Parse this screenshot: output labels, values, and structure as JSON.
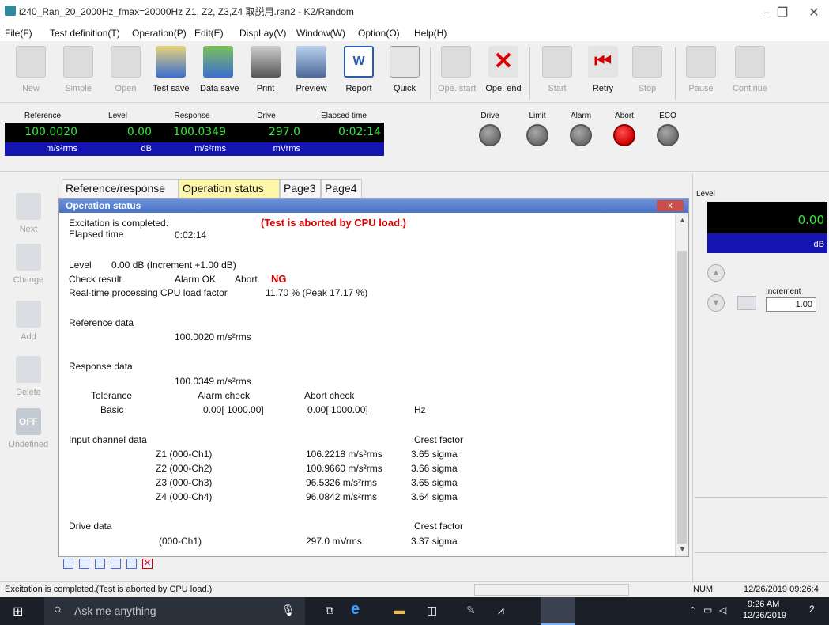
{
  "window": {
    "title": "i240_Ran_20_2000Hz_fmax=20000Hz Z1, Z2, Z3,Z4 取説用.ran2 - K2/Random",
    "minimize": "–",
    "maximize": "❐",
    "close": "✕"
  },
  "menu": [
    "File(F)",
    "Test definition(T)",
    "Operation(P)",
    "Edit(E)",
    "DispLay(V)",
    "Window(W)",
    "Option(O)",
    "Help(H)"
  ],
  "toolbar": {
    "new": "New",
    "simple": "Simple",
    "open": "Open",
    "test_save": "Test save",
    "data_save": "Data save",
    "print": "Print",
    "preview": "Preview",
    "report": "Report",
    "quick": "Quick",
    "ope_start": "Ope. start",
    "ope_end": "Ope. end",
    "start": "Start",
    "retry": "Retry",
    "stop": "Stop",
    "pause": "Pause",
    "continue": "Continue"
  },
  "readouts": {
    "reference": {
      "label": "Reference",
      "value": "100.0020",
      "unit": "m/s²rms"
    },
    "level": {
      "label": "Level",
      "value": "0.00",
      "unit": "dB"
    },
    "response": {
      "label": "Response",
      "value": "100.0349",
      "unit": "m/s²rms"
    },
    "drive": {
      "label": "Drive",
      "value": "297.0",
      "unit": "mVrms"
    },
    "elapsed": {
      "label": "Elapsed time",
      "value": "0:02:14",
      "unit": ""
    }
  },
  "indicators": {
    "drive": {
      "label": "Drive",
      "color": "#7a7a7a"
    },
    "limit": {
      "label": "Limit",
      "color": "#7a7a7a"
    },
    "alarm": {
      "label": "Alarm",
      "color": "#7a7a7a"
    },
    "abort": {
      "label": "Abort",
      "color": "#e00000"
    },
    "eco": {
      "label": "ECO",
      "color": "#7a7a7a"
    }
  },
  "sidebar": {
    "next": "Next",
    "change": "Change",
    "add": "Add",
    "delete": "Delete",
    "undefined": "Undefined",
    "off_icon": "OFF"
  },
  "tabs": [
    "Reference/response",
    "Operation status",
    "Page3",
    "Page4"
  ],
  "panel": {
    "title": "Operation status",
    "close": "x",
    "excitation": "Excitation is completed.",
    "aborted": "(Test is aborted by CPU load.)",
    "elapsed_label": "Elapsed time",
    "elapsed_value": "0:02:14",
    "level_label": "Level",
    "level_value": "0.00 dB (Increment +1.00 dB)",
    "check_label": "Check result",
    "alarm_ok": "Alarm OK",
    "abort_label": "Abort",
    "abort_ng": "NG",
    "cpu_label": "Real-time processing CPU load factor",
    "cpu_value": "11.70 % (Peak 17.17 %)",
    "reference_label": "Reference data",
    "reference_value": "100.0020 m/s²rms",
    "response_label": "Response data",
    "response_value": "100.0349 m/s²rms",
    "tolerance_label": "Tolerance",
    "alarm_check_label": "Alarm check",
    "abort_check_label": "Abort check",
    "basic_label": "Basic",
    "basic_alarm": "0.00[  1000.00]",
    "basic_abort": "0.00[  1000.00]",
    "hz": "Hz",
    "input_label": "Input channel data",
    "crest_label": "Crest factor",
    "channels": [
      {
        "name": "Z1 (000-Ch1)",
        "value": "106.2218 m/s²rms",
        "crest": "3.65 sigma"
      },
      {
        "name": "Z2 (000-Ch2)",
        "value": "100.9660 m/s²rms",
        "crest": "3.66 sigma"
      },
      {
        "name": "Z3 (000-Ch3)",
        "value": "96.5326 m/s²rms",
        "crest": "3.65 sigma"
      },
      {
        "name": "Z4 (000-Ch4)",
        "value": "96.0842 m/s²rms",
        "crest": "3.64 sigma"
      }
    ],
    "drive_label": "Drive data",
    "drive_crest_label": "Crest factor",
    "drive_channel": "(000-Ch1)",
    "drive_value": "297.0 mVrms",
    "drive_crest": "3.37 sigma"
  },
  "right_panel": {
    "level_label": "Level",
    "level_value": "0.00",
    "level_unit": "dB",
    "increment_label": "Increment",
    "increment_value": "1.00"
  },
  "status": {
    "message": "Excitation is completed.(Test is aborted by CPU load.)",
    "num": "NUM",
    "datetime": "12/26/2019  09:26:4"
  },
  "taskbar": {
    "search_placeholder": "Ask me anything",
    "time": "9:26 AM",
    "date": "12/26/2019",
    "notif_count": "2"
  }
}
